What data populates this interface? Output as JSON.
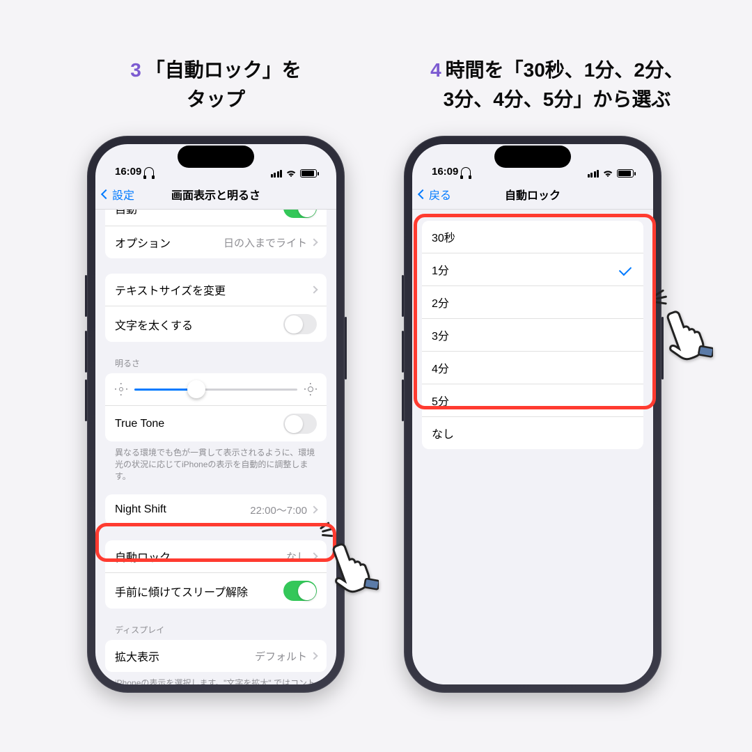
{
  "step3": {
    "num": "3",
    "text": "「自動ロック」を\nタップ"
  },
  "step4": {
    "num": "4",
    "text": "時間を「30秒、1分、2分、\n3分、4分、5分」から選ぶ"
  },
  "status": {
    "time": "16:09"
  },
  "left": {
    "back": "設定",
    "title": "画面表示と明るさ",
    "auto_label": "自動",
    "options": {
      "label": "オプション",
      "value": "日の入までライト"
    },
    "textsize": "テキストサイズを変更",
    "bold": "文字を太くする",
    "brightness_header": "明るさ",
    "truetone": "True Tone",
    "truetone_caption": "異なる環境でも色が一貫して表示されるように、環境光の状況に応じてiPhoneの表示を自動的に調整します。",
    "nightshift": {
      "label": "Night Shift",
      "value": "22:00～7:00"
    },
    "autolock": {
      "label": "自動ロック",
      "value": "なし"
    },
    "raise": "手前に傾けてスリープ解除",
    "display_header": "ディスプレイ",
    "zoom": {
      "label": "拡大表示",
      "value": "デフォルト"
    },
    "zoom_caption": "iPhoneの表示を選択します。\"文字を拡大\" ではコントロールが拡大表示されます。\"デフォルト\" ではより多くの内容が表示されます。"
  },
  "right": {
    "back": "戻る",
    "title": "自動ロック",
    "options": [
      "30秒",
      "1分",
      "2分",
      "3分",
      "4分",
      "5分",
      "なし"
    ],
    "selected": "1分"
  }
}
